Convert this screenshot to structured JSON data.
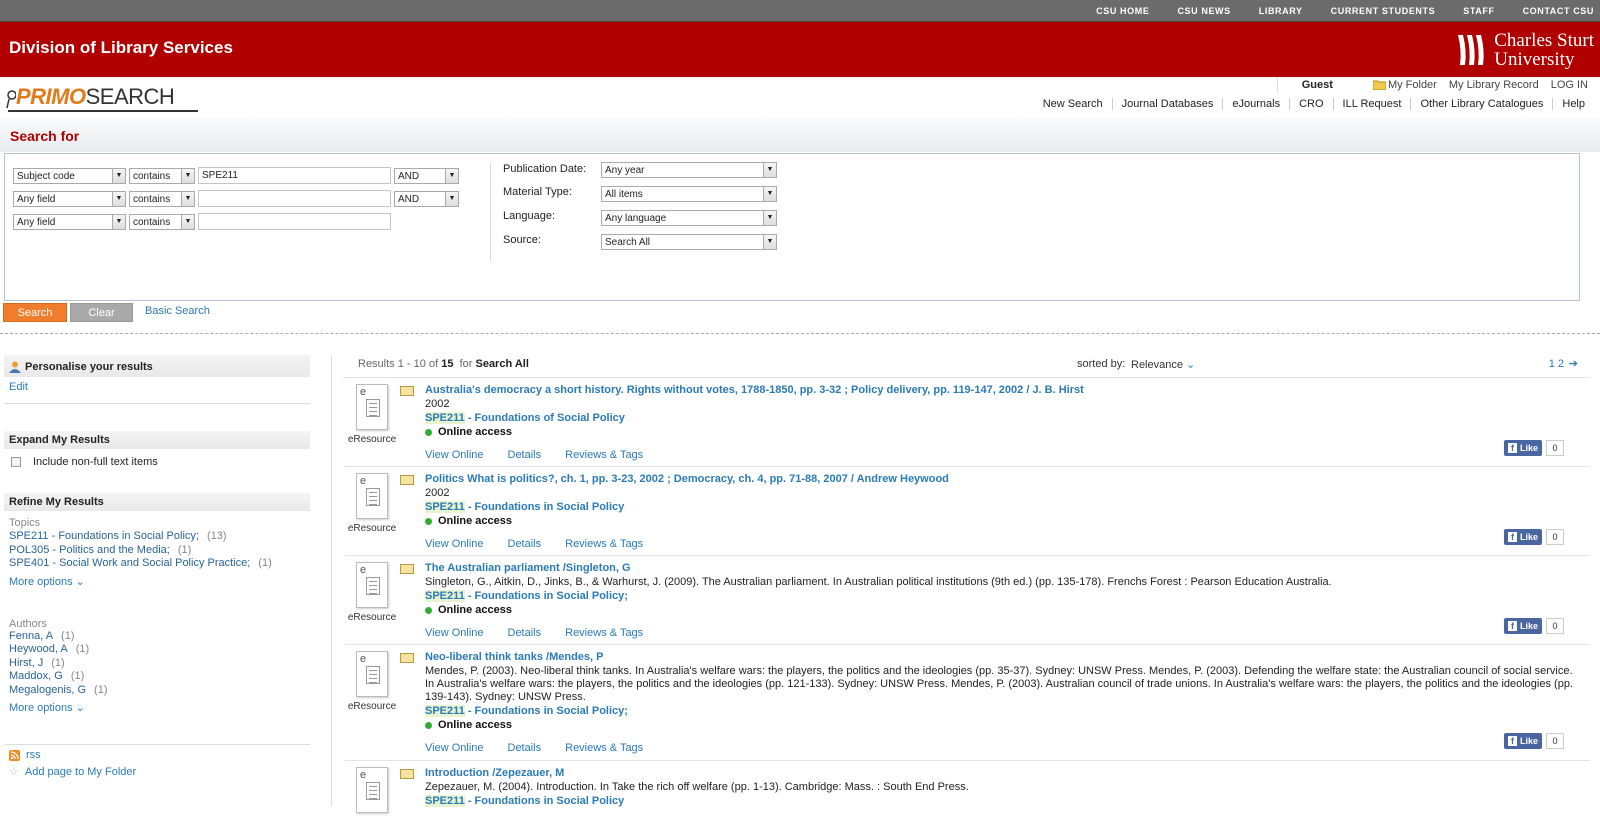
{
  "top_nav": {
    "items": [
      "CSU HOME",
      "CSU NEWS",
      "LIBRARY",
      "CURRENT STUDENTS",
      "STAFF",
      "CONTACT CSU"
    ]
  },
  "header": {
    "division_title": "Division of Library Services",
    "university_line1": "Charles Sturt",
    "university_line2": "University"
  },
  "logo": {
    "primo": "PRIMO",
    "search": "SEARCH"
  },
  "user_bar": {
    "guest": "Guest",
    "my_folder": "My Folder",
    "my_library_record": "My Library Record",
    "login": "LOG IN"
  },
  "main_links": [
    "New Search",
    "Journal Databases",
    "eJournals",
    "CRO",
    "ILL Request",
    "Other Library Catalogues",
    "Help"
  ],
  "search_for": {
    "heading": "Search for",
    "rows": [
      {
        "field": "Subject code",
        "operator": "contains",
        "value": "SPE211",
        "bool": "AND"
      },
      {
        "field": "Any field",
        "operator": "contains",
        "value": "",
        "bool": "AND"
      },
      {
        "field": "Any field",
        "operator": "contains",
        "value": ""
      }
    ],
    "filters": [
      {
        "label": "Publication Date:",
        "value": "Any year"
      },
      {
        "label": "Material Type:",
        "value": "All items"
      },
      {
        "label": "Language:",
        "value": "Any language"
      },
      {
        "label": "Source:",
        "value": "Search All"
      }
    ],
    "search_button": "Search",
    "clear_button": "Clear",
    "basic_search": "Basic Search"
  },
  "sidebar": {
    "personalise": "Personalise your results",
    "edit": "Edit",
    "expand_heading": "Expand My Results",
    "include_label": "Include non-full text items",
    "refine_heading": "Refine My Results",
    "topics_label": "Topics",
    "topics": [
      {
        "label": "SPE211 - Foundations in Social Policy;",
        "count": "(13)"
      },
      {
        "label": "POL305 - Politics and the Media;",
        "count": "(1)"
      },
      {
        "label": "SPE401 - Social Work and Social Policy Practice;",
        "count": "(1)"
      }
    ],
    "more_options": "More options",
    "authors_label": "Authors",
    "authors": [
      {
        "label": "Fenna, A",
        "count": "(1)"
      },
      {
        "label": "Heywood, A",
        "count": "(1)"
      },
      {
        "label": "Hirst, J",
        "count": "(1)"
      },
      {
        "label": "Maddox, G",
        "count": "(1)"
      },
      {
        "label": "Megalogenis, G",
        "count": "(1)"
      }
    ],
    "rss": "rss",
    "add_page": "Add page to My Folder"
  },
  "results_header": {
    "results_word": "Results",
    "range": "1 - 10",
    "of_word": "of",
    "total": "15",
    "for_word": "for",
    "scope": "Search All",
    "sorted_by": "sorted by:",
    "sort_value": "Relevance",
    "pages": "1 2"
  },
  "record_labels": {
    "type": "eResource",
    "view_online": "View Online",
    "details": "Details",
    "reviews": "Reviews & Tags",
    "like": "Like",
    "like_count": "0"
  },
  "results": [
    {
      "title": "Australia's democracy a short history. Rights without votes, 1788-1850, pp. 3-32 ; Policy delivery, pp. 119-147, 2002 / J. B. Hirst",
      "info": "2002",
      "subject_code": "SPE211",
      "subject_rest": " - Foundations of Social Policy",
      "availability": "Online access"
    },
    {
      "title": "Politics What is politics?, ch. 1, pp. 3-23, 2002 ; Democracy, ch. 4, pp. 71-88, 2007 / Andrew Heywood",
      "info": "2002",
      "subject_code": "SPE211",
      "subject_rest": " - Foundations in Social Policy",
      "availability": "Online access"
    },
    {
      "title": "The Australian parliament /Singleton, G",
      "info": "Singleton, G., Aitkin, D., Jinks, B., & Warhurst, J. (2009). The Australian parliament. In Australian political institutions (9th ed.) (pp. 135-178). Frenchs Forest : Pearson Education Australia.",
      "subject_code": "SPE211",
      "subject_rest": " - Foundations in Social Policy;",
      "availability": "Online access"
    },
    {
      "title": "Neo-liberal think tanks /Mendes, P",
      "info1": "Mendes, P. (2003). Neo-liberal think tanks. In Australia's welfare wars: the players, the politics and the ideologies (pp. 35-37). Sydney: UNSW Press. Mendes, P. (2003). Defending the welfare state: the Australian council of social service.",
      "info2": "In Australia's welfare wars: the players, the politics and the ideologies (pp. 121-133). Sydney: UNSW Press. Mendes, P. (2003). Australian council of trade unions. In Australia's welfare wars: the players, the politics and the ideologies (pp.",
      "info3": "139-143). Sydney: UNSW Press.",
      "subject_code": "SPE211",
      "subject_rest": " - Foundations in Social Policy;",
      "availability": "Online access"
    },
    {
      "title": "Introduction /Zepezauer, M",
      "info": "Zepezauer, M. (2004). Introduction. In Take the rich off welfare (pp. 1-13). Cambridge: Mass. : South End Press.",
      "subject_code": "SPE211",
      "subject_rest": " - Foundations in Social Policy"
    }
  ],
  "colors": {
    "red_bar": "#b00000",
    "top_nav": "#6b6b6b",
    "link": "#2a7bb8",
    "search_btn": "#f07d2c"
  }
}
